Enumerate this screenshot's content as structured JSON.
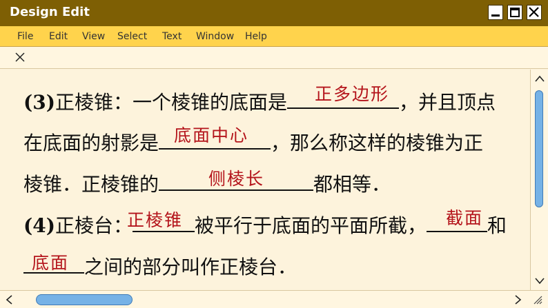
{
  "window": {
    "title": "Design Edit",
    "colors": {
      "titlebar": "#7e5f04",
      "menubar": "#ffd34c",
      "background": "#fdf3dc",
      "answer": "#b4141b",
      "scroll_thumb": "#76b2e6"
    }
  },
  "menu": {
    "items": [
      "File",
      "Edit",
      "View",
      "Select",
      "Text",
      "Window",
      "Help"
    ]
  },
  "icons": {
    "minimize": "minimize-icon",
    "maximize": "maximize-icon",
    "close": "close-icon",
    "tab_close": "close-icon"
  },
  "document": {
    "line1": {
      "num": "(3)",
      "a": "正棱锥：一个棱锥的底面是",
      "b": "，并且顶点"
    },
    "line2": {
      "a": "在底面的射影是",
      "b": "，那么称这样的棱锥为正"
    },
    "line3": {
      "a": "棱锥．正棱锥的",
      "b": "都相等．"
    },
    "line4": {
      "num": "(4)",
      "a": "正棱台：",
      "b": "被平行于底面的平面所截，",
      "c": "和"
    },
    "line5": {
      "b": "之间的部分叫作正棱台．"
    },
    "answers": [
      "正多边形",
      "底面中心",
      "侧棱长",
      "正棱锥",
      "截面",
      "底面"
    ]
  }
}
